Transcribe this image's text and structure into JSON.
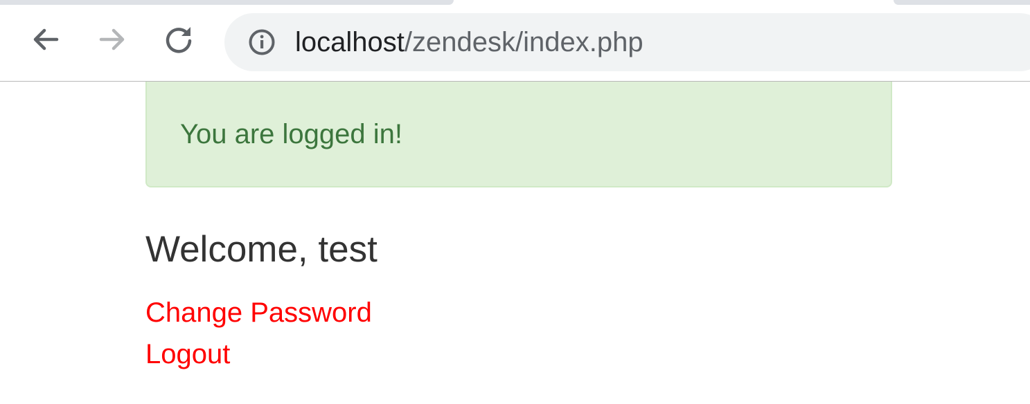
{
  "browser": {
    "url_host": "localhost",
    "url_path": "/zendesk/index.php",
    "icons": {
      "back": "arrow-left-icon",
      "forward": "arrow-right-icon",
      "reload": "reload-icon",
      "site_info": "info-icon"
    }
  },
  "alert": {
    "message": "You are logged in!",
    "background": "#dff0d8",
    "text_color": "#3c763d"
  },
  "main": {
    "welcome": "Welcome, test",
    "links": {
      "change_password": "Change Password",
      "logout": "Logout"
    },
    "link_color": "#ff0000"
  }
}
